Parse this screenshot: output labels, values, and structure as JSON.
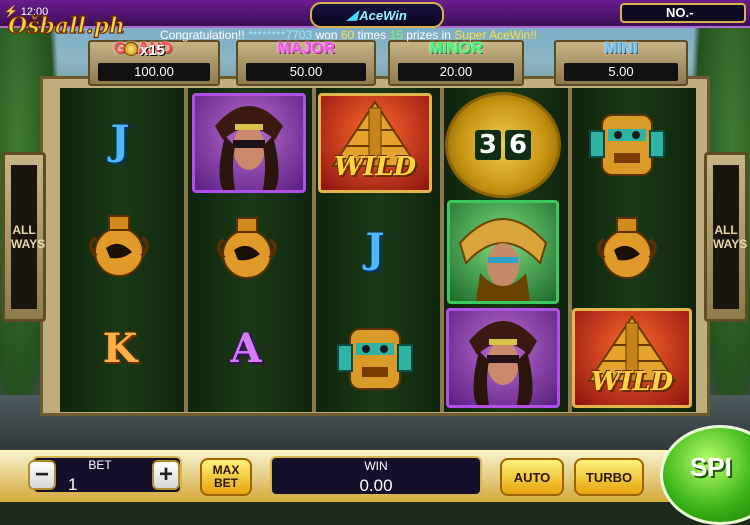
{
  "status": {
    "time": "12:00"
  },
  "brand": {
    "logo_text": "Ošball.ph"
  },
  "header": {
    "acewin_label": "AceWin",
    "no_label": "NO.-"
  },
  "ticker": {
    "prefix": "Congratulation!!",
    "masked_id": "********7703",
    "won": "won",
    "times_value": "60",
    "times": "times",
    "prizes_value": "15",
    "prizes_in": "prizes in",
    "game": "Super AceWin!!"
  },
  "jackpots": {
    "grand": {
      "label": "GRAND",
      "value": "100.00",
      "multiplier": "x15"
    },
    "major": {
      "label": "MAJOR",
      "value": "50.00"
    },
    "minor": {
      "label": "MINOR",
      "value": "20.00"
    },
    "mini": {
      "label": "MINI",
      "value": "5.00"
    }
  },
  "side_panel": {
    "line1": "ALL",
    "line2": "WAYS"
  },
  "reels": [
    [
      "letter-j",
      "jar",
      "letter-k"
    ],
    [
      "priestess",
      "jar",
      "letter-a"
    ],
    [
      "wild-pyramid",
      "letter-j",
      "mask"
    ],
    [
      "calendar-3.6",
      "jaguar-warrior",
      "priestess"
    ],
    [
      "mask",
      "jar",
      "wild-pyramid"
    ]
  ],
  "symbols": {
    "letter_j": "J",
    "letter_k": "K",
    "letter_a": "A",
    "wild": "WILD",
    "calendar_left": "3",
    "calendar_right": "6"
  },
  "controls": {
    "bet_label": "BET",
    "bet_value": "1",
    "minus": "−",
    "plus": "+",
    "max_bet_line1": "MAX",
    "max_bet_line2": "BET",
    "win_label": "WIN",
    "win_value": "0.00",
    "auto": "AUTO",
    "turbo": "TURBO",
    "spin": "SPI"
  },
  "colors": {
    "topbar": "#6a1d8e",
    "gold": "#d9b451",
    "spin_green": "#35b013"
  }
}
